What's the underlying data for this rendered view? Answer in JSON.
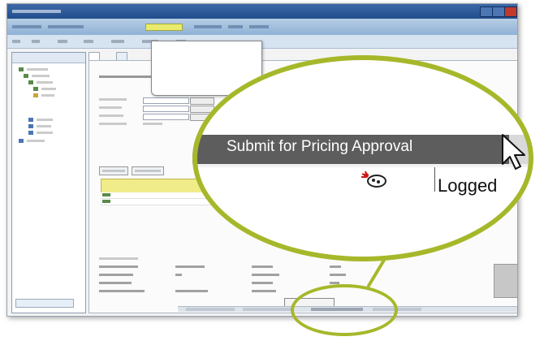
{
  "magnifier": {
    "button_label": "Submit for Pricing Approval",
    "status_text": "Logged"
  },
  "colors": {
    "accent_ring": "#a6b82a",
    "header_bar": "#5d5d5d",
    "grid_header": "#f1ec8a",
    "nav_bar": "#8fb1d6"
  },
  "icons": {
    "cursor": "mouse-pointer-icon",
    "status_logo": "status-logo-icon"
  }
}
